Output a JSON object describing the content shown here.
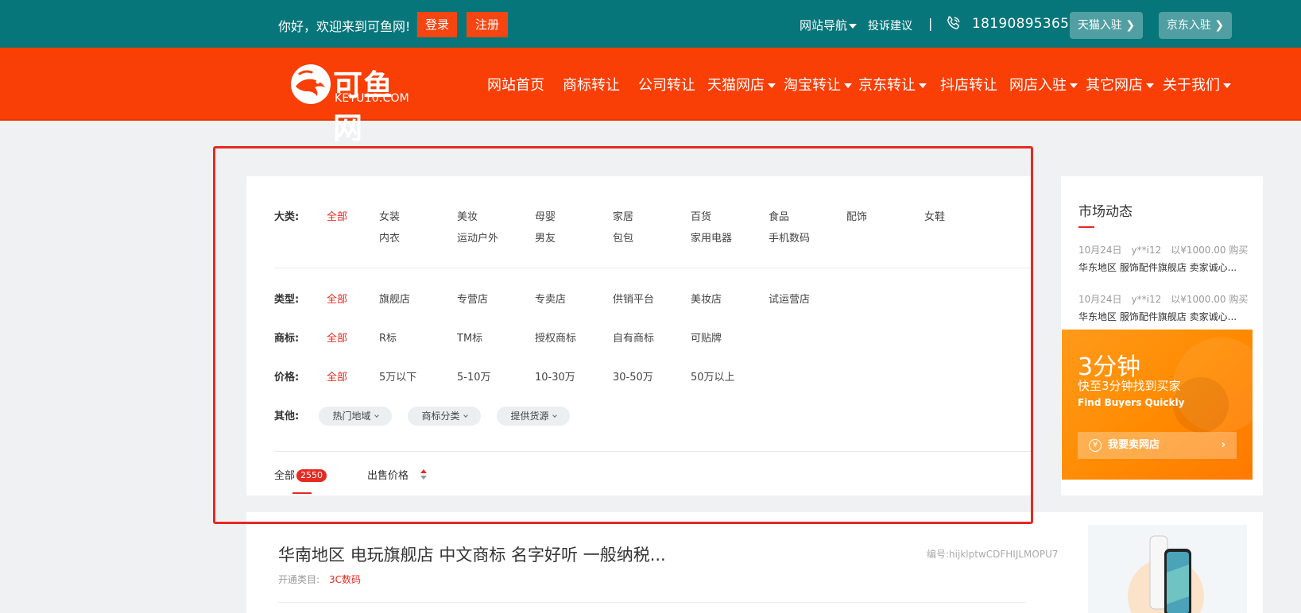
{
  "topbar": {
    "welcome": "你好，欢迎来到可鱼网!",
    "login": "登录",
    "register": "注册",
    "site_nav": "网站导航",
    "complaint": "投诉建议",
    "separator": "|",
    "phone": "18190895365",
    "tmall_join": "天猫入驻",
    "jd_join": "京东入驻",
    "bg_color": "#07767a"
  },
  "header": {
    "logo_name": "可鱼网",
    "logo_domain": "KEYU10.COM",
    "bg_color": "#f93e06",
    "nav": [
      {
        "label": "网站首页",
        "dropdown": false
      },
      {
        "label": "商标转让",
        "dropdown": false
      },
      {
        "label": "公司转让",
        "dropdown": false
      },
      {
        "label": "天猫网店",
        "dropdown": true
      },
      {
        "label": "淘宝转让",
        "dropdown": true
      },
      {
        "label": "京东转让",
        "dropdown": true
      },
      {
        "label": "抖店转让",
        "dropdown": false
      },
      {
        "label": "网店入驻",
        "dropdown": true
      },
      {
        "label": "其它网店",
        "dropdown": true
      },
      {
        "label": "关于我们",
        "dropdown": true
      }
    ]
  },
  "filters": {
    "category": {
      "label": "大类:",
      "all": "全部",
      "row1": [
        "女装",
        "美妆",
        "母婴",
        "家居",
        "百货",
        "食品",
        "配饰",
        "女鞋"
      ],
      "row2": [
        "内衣",
        "运动户外",
        "男友",
        "包包",
        "家用电器",
        "手机数码"
      ]
    },
    "type": {
      "label": "类型:",
      "all": "全部",
      "items": [
        "旗舰店",
        "专营店",
        "专卖店",
        "供销平台",
        "美妆店",
        "试运营店"
      ]
    },
    "trademark": {
      "label": "商标:",
      "all": "全部",
      "items": [
        "R标",
        "TM标",
        "授权商标",
        "自有商标",
        "可贴牌"
      ]
    },
    "price": {
      "label": "价格:",
      "all": "全部",
      "items": [
        "5万以下",
        "5-10万",
        "10-30万",
        "30-50万",
        "50万以上"
      ]
    },
    "other": {
      "label": "其他:",
      "dropdowns": [
        "热门地域",
        "商标分类",
        "提供货源"
      ]
    },
    "sort": {
      "all_label": "全部",
      "count": "2550",
      "price_label": "出售价格"
    }
  },
  "sidebar": {
    "title": "市场动态",
    "news": [
      {
        "date": "10月24日",
        "user": "y**i12",
        "action": "以¥1000.00 购买",
        "text": "华东地区 服饰配件旗舰店 卖家诚心..."
      },
      {
        "date": "10月24日",
        "user": "y**i12",
        "action": "以¥1000.00 购买",
        "text": "华东地区 服饰配件旗舰店 卖家诚心..."
      }
    ],
    "promo": {
      "headline": "3分钟",
      "subline": "快至3分钟找到买家",
      "english": "Find Buyers Quickly",
      "cta": "我要卖网店",
      "yen": "¥",
      "arrow": "›"
    }
  },
  "listing": {
    "title": "华南地区 电玩旗舰店 中文商标 名字好听 一般纳税...",
    "code": "编号:hijklptwCDFHIJLMOPU7",
    "category_label": "开通类目:",
    "category_value": "3C数码"
  },
  "colors": {
    "accent_red": "#e52a22",
    "teal": "#07767a",
    "orange": "#f93e06"
  }
}
